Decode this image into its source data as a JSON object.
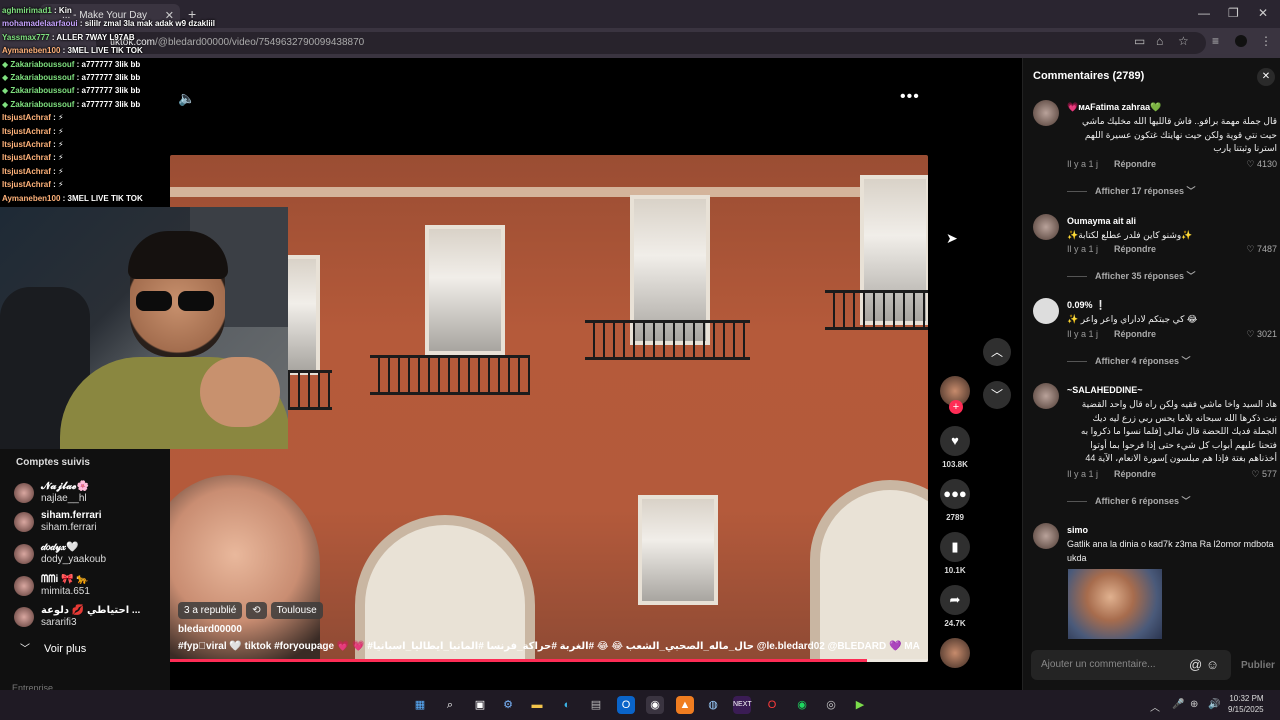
{
  "browser": {
    "tab_title": "... - Make Your Day",
    "tab_close": "✕",
    "new_tab": "+",
    "url_host": "tiktok.com",
    "url_path": "/@bledard00000/video/7549632790099438870",
    "window_controls": [
      "—",
      "❐",
      "✕"
    ]
  },
  "chat": [
    {
      "user": "aghmirimad1",
      "msg": ": Kin",
      "cls": "u"
    },
    {
      "user": "mohamadelaarfaoui",
      "msg": ": sililr zmal 3la mak adak w9 dzakliil",
      "cls": "u2"
    },
    {
      "user": "Yassmax777",
      "msg": ": ALLER 7WAY L97AB",
      "cls": "u"
    },
    {
      "user": "Aymaneben100",
      "msg": ": 3MEL LIVE TIK TOK",
      "cls": "u3"
    },
    {
      "user": "◆ Zakariaboussouf",
      "msg": ": a777777 3lik bb",
      "cls": "u"
    },
    {
      "user": "◆ Zakariaboussouf",
      "msg": ": a777777 3lik bb",
      "cls": "u"
    },
    {
      "user": "◆ Zakariaboussouf",
      "msg": ": a777777 3lik bb",
      "cls": "u"
    },
    {
      "user": "◆ Zakariaboussouf",
      "msg": ": a777777 3lik bb",
      "cls": "u"
    },
    {
      "user": "ItsjustAchraf",
      "msg": ": ⚡",
      "cls": "u3"
    },
    {
      "user": "ItsjustAchraf",
      "msg": ": ⚡",
      "cls": "u3"
    },
    {
      "user": "ItsjustAchraf",
      "msg": ": ⚡",
      "cls": "u3"
    },
    {
      "user": "ItsjustAchraf",
      "msg": ": ⚡",
      "cls": "u3"
    },
    {
      "user": "ItsjustAchraf",
      "msg": ": ⚡",
      "cls": "u3"
    },
    {
      "user": "ItsjustAchraf",
      "msg": ": ⚡",
      "cls": "u3"
    },
    {
      "user": "Aymaneben100",
      "msg": ": 3MEL LIVE TIK TOK",
      "cls": "u3"
    }
  ],
  "video": {
    "location": "Toulouse",
    "republish": "3 a republié",
    "author": "bledard00000",
    "tags": "#fyp゚viral 🤍 tiktok #foryoupage 💗 💗 #حال_ماله_الصحبي_الشعب 😂 😂 #الغربة #حراكة_فرنسا #المانيا_ايطاليا_اسبانيا @le.bledard02 @BLEDARD 💜 MA",
    "progress": 0.92,
    "more": "•••",
    "sound": "🔈"
  },
  "actions": {
    "plus": "+",
    "like_count": "103.8K",
    "comment_count": "2789",
    "save_count": "10.1K",
    "share_count": "24.7K",
    "up": "︿",
    "down": "﹀"
  },
  "followed": {
    "title": "Comptes suivis",
    "accounts": [
      {
        "display": "𝓝𝓪𝓳𝓵𝓪𝓮🌸",
        "handle": "najlae__hl"
      },
      {
        "display": "siham.ferrari",
        "handle": "siham.ferrari"
      },
      {
        "display": "𝒹𝑜𝒹𝓎𝓍🤍",
        "handle": "dody_yaakoub"
      },
      {
        "display": "ᗰᗰi 🎀 🐆",
        "handle": "mimita.651"
      },
      {
        "display": "احتياطي 💋 دلوعة ...",
        "handle": "sararifi3"
      }
    ],
    "voir_plus": "Voir plus",
    "faint_label": "Entreprise"
  },
  "comments": {
    "title": "Commentaires (2789)",
    "close": "✕",
    "items": [
      {
        "name": "💗ᴍᴀFatima zahraa💚",
        "text": "قال جملة مهمة برافو.. فاش قالليها الله مخليك ماشي حيت نتي قوية ولكن حيت نهايتك غتكون عسيرة اللهم استرنا وثبتنا يارب",
        "ago": "Il y a 1 j",
        "reply": "Répondre",
        "likes": "4130",
        "more_replies": "Afficher 17 réponses"
      },
      {
        "name": "Oumayma ait ali",
        "text": "✨وشنو كاين فلدر عطلع لكتابة✨",
        "ago": "Il y a 1 j",
        "reply": "Répondre",
        "likes": "7487",
        "more_replies": "Afficher 35 réponses"
      },
      {
        "name": "0.09% ❕",
        "text": "✨ كي جبتكم لاداراي واعر واعر 😂",
        "ago": "Il y a 1 j",
        "reply": "Répondre",
        "likes": "3021",
        "more_replies": "Afficher 4 réponses"
      },
      {
        "name": "~SALAHEDDINE~",
        "text": "هاد السيد واخا ماشي فقيه ولكن راه قال واحد القضية نيت ذكرها الله سبحانه بلاما يحس ربي زرع ليه ديك الجملة فديك اللحضة قال تعالى [فلما نسوا ما ذكروا به فتحنا عليهم أبواب كل شيء حتى إذا فرحوا بما أوتوا أخذناهم بغتة فإذا هم مبلسون ]سورة الانعام، الآية 44",
        "ago": "Il y a 1 j",
        "reply": "Répondre",
        "likes": "577",
        "more_replies": "Afficher 6 réponses"
      },
      {
        "name": "simo",
        "text": "Gatlik ana la dinia o kad7k z3ma Ra l2omor mdbota ukda",
        "ago": "",
        "reply": "",
        "likes": "",
        "more_replies": ""
      }
    ],
    "input_placeholder": "Ajouter un commentaire...",
    "publish": "Publier"
  },
  "taskbar": {
    "time": "10:32 PM",
    "date": "9/15/2025"
  },
  "colors": {
    "accent": "#fe2c55",
    "panel": "#121212"
  }
}
